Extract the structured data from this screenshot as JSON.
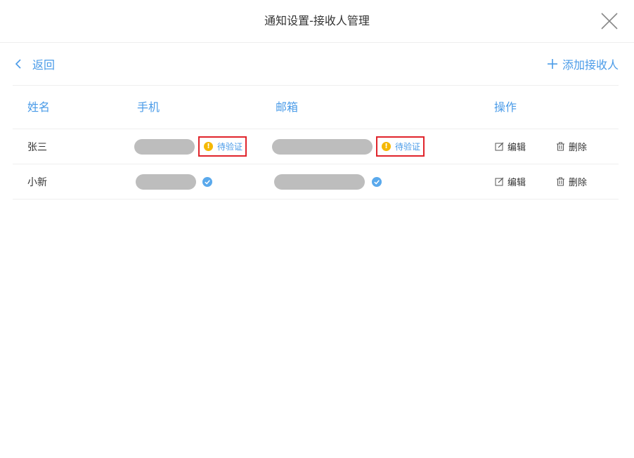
{
  "dialog": {
    "title": "通知设置-接收人管理"
  },
  "toolbar": {
    "back_label": "返回",
    "add_label": "添加接收人"
  },
  "table": {
    "headers": {
      "name": "姓名",
      "phone": "手机",
      "email": "邮箱",
      "actions": "操作"
    },
    "rows": [
      {
        "name": "张三",
        "phone_status": "待验证",
        "email_status": "待验证",
        "edit_label": "编辑",
        "delete_label": "删除"
      },
      {
        "name": "小新",
        "phone_status": "verified",
        "email_status": "verified",
        "edit_label": "编辑",
        "delete_label": "删除"
      }
    ]
  },
  "colors": {
    "accent": "#4a9be8",
    "warning": "#f5b800",
    "highlight_border": "#e0242b",
    "mask": "#bdbdbd"
  },
  "icons": {
    "close": "close-icon",
    "back": "chevron-left-icon",
    "add": "plus-icon",
    "pending": "warning-icon",
    "verified": "check-circle-icon",
    "edit": "edit-icon",
    "delete": "trash-icon"
  }
}
